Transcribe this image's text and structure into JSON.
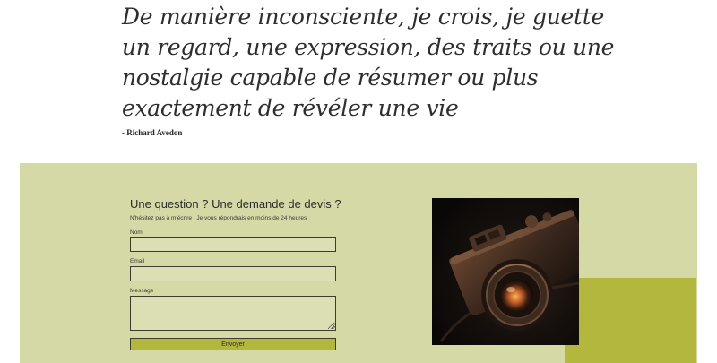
{
  "quote": {
    "text": "De manière inconsciente, je crois, je guette un regard, une expression, des traits ou une nostalgie capable de résumer ou plus exactement de révéler une vie",
    "author": "- Richard Avedon"
  },
  "contact": {
    "title": "Une question ? Une demande de devis ?",
    "subtitle": "N'hésitez pas à m'écrire ! Je vous répondrais en moins de 24 heures",
    "fields": {
      "name_label": "Nom",
      "name_value": "",
      "email_label": "Email",
      "email_value": "",
      "message_label": "Message",
      "message_value": ""
    },
    "submit_label": "Envoyer"
  },
  "photo": {
    "subject": "camera-photo"
  },
  "colors": {
    "section_background": "#d5d9a6",
    "accent": "#b3b73e",
    "input_background": "#dcdfb3",
    "border": "#3d3d2e",
    "quote_text": "#2e2e2e"
  }
}
